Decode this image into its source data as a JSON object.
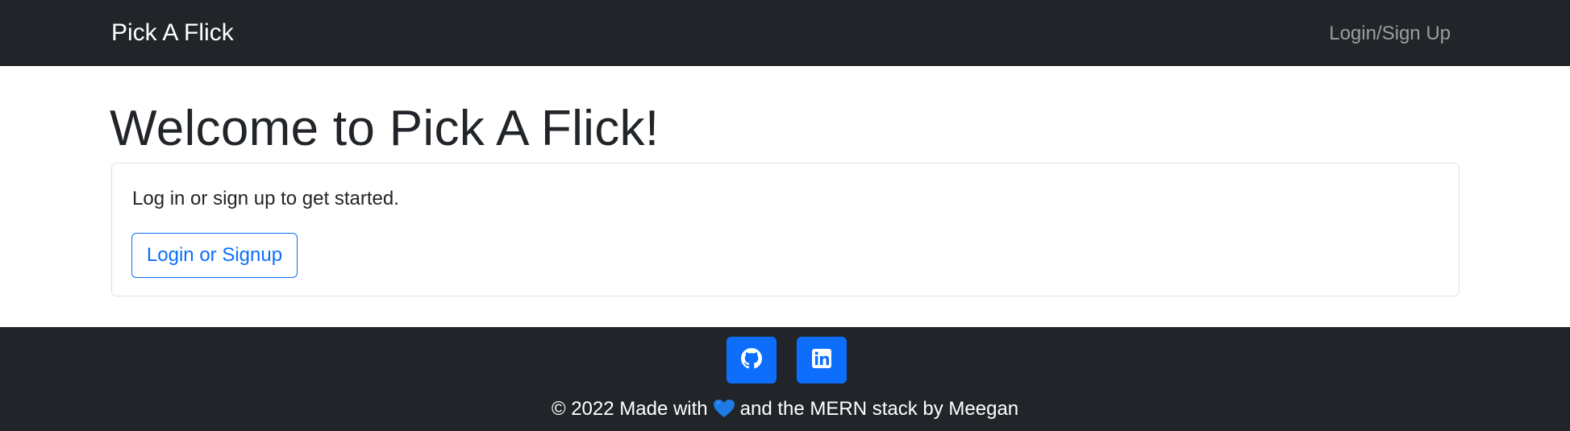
{
  "navbar": {
    "brand": "Pick A Flick",
    "login_link": "Login/Sign Up"
  },
  "main": {
    "heading": "Welcome to Pick A Flick!",
    "card_text": "Log in or sign up to get started.",
    "button_label": "Login or Signup"
  },
  "footer": {
    "social": [
      {
        "icon": "github-icon"
      },
      {
        "icon": "linkedin-icon"
      }
    ],
    "text_before": "© 2022 Made with",
    "heart_icon": "blue-heart-icon",
    "text_after": "and the MERN stack by Meegan"
  },
  "colors": {
    "dark_bg": "#212529",
    "primary": "#0d6efd",
    "white": "#ffffff"
  }
}
